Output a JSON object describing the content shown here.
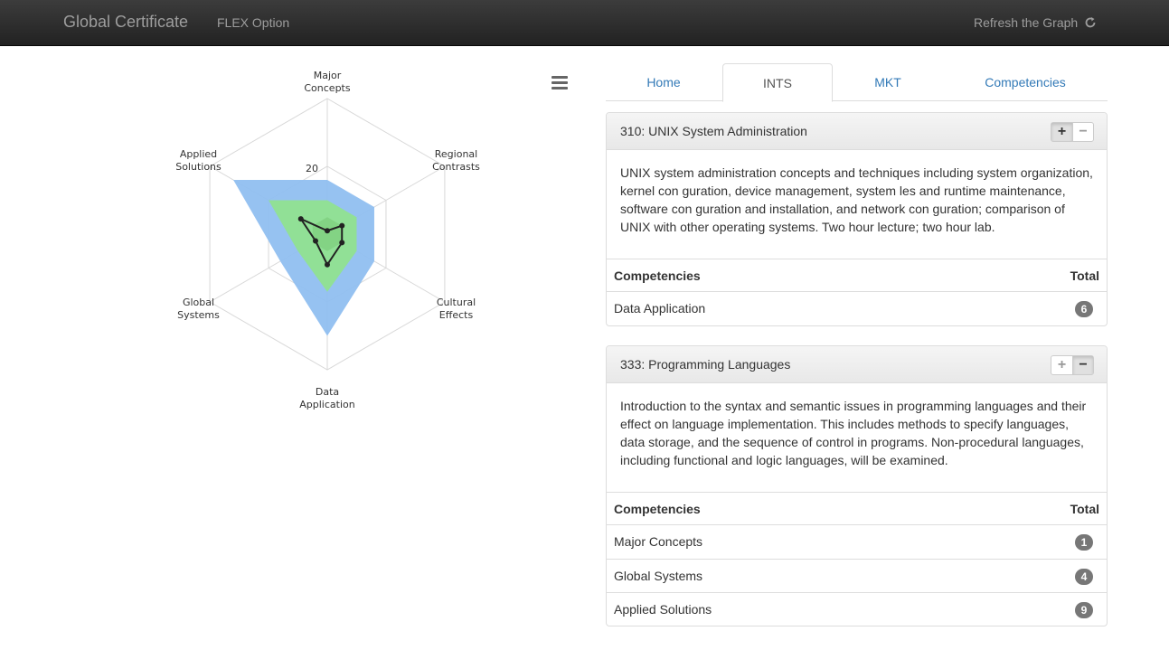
{
  "navbar": {
    "brand": "Global Certificate",
    "option": "FLEX Option",
    "refresh": "Refresh the Graph"
  },
  "tabs": [
    {
      "label": "Home",
      "active": false
    },
    {
      "label": "INTS",
      "active": true
    },
    {
      "label": "MKT",
      "active": false
    },
    {
      "label": "Competencies",
      "active": false
    }
  ],
  "chart_data": {
    "type": "radar",
    "axes": [
      "Major Concepts",
      "Regional Contrasts",
      "Cultural Effects",
      "Data Application",
      "Global Systems",
      "Applied Solutions"
    ],
    "tick_labels": [
      "20"
    ],
    "series": [
      {
        "values": [
          16,
          16,
          16,
          30,
          16,
          32
        ],
        "color": "#90bff0"
      },
      {
        "values": [
          10,
          10,
          10,
          17,
          10,
          20
        ],
        "color": "#90e290"
      },
      {
        "values": [
          5,
          5,
          5,
          5,
          5,
          5
        ],
        "color": "#7fcf7f"
      },
      {
        "values": [
          1,
          5,
          5,
          9,
          4,
          9
        ],
        "color": "#222222"
      }
    ],
    "max": 40
  },
  "panels": [
    {
      "title": "310: UNIX System Administration",
      "description": "UNIX system administration concepts and techniques including system organization, kernel con guration, device management, system les and runtime maintenance, software con guration and installation, and network con guration; comparison of UNIX with other operating systems. Two hour lecture; two hour lab.",
      "header_left": "Competencies",
      "header_right": "Total",
      "rows": [
        {
          "label": "Data Application",
          "total": "6"
        }
      ]
    },
    {
      "title": "333: Programming Languages",
      "description": "Introduction to the syntax and semantic issues in programming languages and their effect on language implementation. This includes methods to specify languages, data storage, and the sequence of control in programs. Non-procedural languages, including functional and logic languages, will be examined.",
      "header_left": "Competencies",
      "header_right": "Total",
      "rows": [
        {
          "label": "Major Concepts",
          "total": "1"
        },
        {
          "label": "Global Systems",
          "total": "4"
        },
        {
          "label": "Applied Solutions",
          "total": "9"
        }
      ]
    }
  ]
}
